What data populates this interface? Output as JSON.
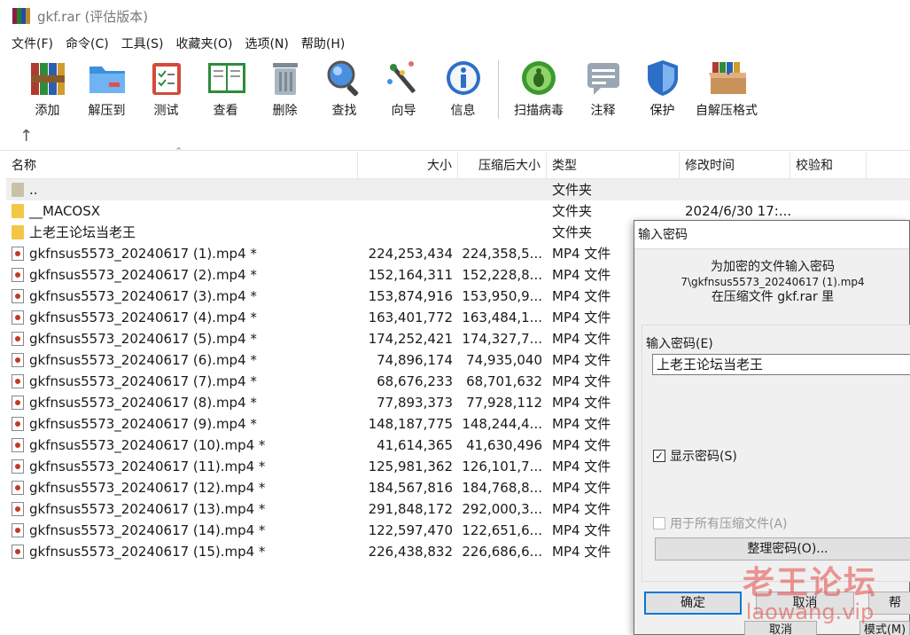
{
  "window": {
    "title": "gkf.rar (评估版本)"
  },
  "menu": [
    "文件(F)",
    "命令(C)",
    "工具(S)",
    "收藏夹(O)",
    "选项(N)",
    "帮助(H)"
  ],
  "toolbar": [
    {
      "label": "添加",
      "icon": "add-books-icon"
    },
    {
      "label": "解压到",
      "icon": "extract-folder-icon"
    },
    {
      "label": "测试",
      "icon": "test-clipboard-icon"
    },
    {
      "label": "查看",
      "icon": "view-book-icon"
    },
    {
      "label": "删除",
      "icon": "trash-icon"
    },
    {
      "label": "查找",
      "icon": "magnifier-icon"
    },
    {
      "label": "向导",
      "icon": "wizard-wand-icon"
    },
    {
      "label": "信息",
      "icon": "info-icon"
    },
    {
      "label": "扫描病毒",
      "icon": "virus-scan-icon"
    },
    {
      "label": "注释",
      "icon": "comment-icon"
    },
    {
      "label": "保护",
      "icon": "shield-icon"
    },
    {
      "label": "自解压格式",
      "icon": "sfx-box-icon"
    }
  ],
  "columns": {
    "name": "名称",
    "size": "大小",
    "packed": "压缩后大小",
    "type": "类型",
    "modified": "修改时间",
    "crc": "校验和"
  },
  "rows": [
    {
      "name": "..",
      "size": "",
      "packed": "",
      "type": "文件夹",
      "modified": "",
      "kind": "parent"
    },
    {
      "name": "__MACOSX",
      "size": "",
      "packed": "",
      "type": "文件夹",
      "modified": "2024/6/30 17:...",
      "kind": "folder"
    },
    {
      "name": "上老王论坛当老王",
      "size": "",
      "packed": "",
      "type": "文件夹",
      "modified": "",
      "kind": "folder"
    },
    {
      "name": "gkfnsus5573_20240617 (1).mp4 *",
      "size": "224,253,434",
      "packed": "224,358,5...",
      "type": "MP4 文件",
      "modified": "",
      "kind": "file"
    },
    {
      "name": "gkfnsus5573_20240617 (2).mp4 *",
      "size": "152,164,311",
      "packed": "152,228,8...",
      "type": "MP4 文件",
      "modified": "",
      "kind": "file"
    },
    {
      "name": "gkfnsus5573_20240617 (3).mp4 *",
      "size": "153,874,916",
      "packed": "153,950,9...",
      "type": "MP4 文件",
      "modified": "",
      "kind": "file"
    },
    {
      "name": "gkfnsus5573_20240617 (4).mp4 *",
      "size": "163,401,772",
      "packed": "163,484,1...",
      "type": "MP4 文件",
      "modified": "",
      "kind": "file"
    },
    {
      "name": "gkfnsus5573_20240617 (5).mp4 *",
      "size": "174,252,421",
      "packed": "174,327,7...",
      "type": "MP4 文件",
      "modified": "",
      "kind": "file"
    },
    {
      "name": "gkfnsus5573_20240617 (6).mp4 *",
      "size": "74,896,174",
      "packed": "74,935,040",
      "type": "MP4 文件",
      "modified": "",
      "kind": "file"
    },
    {
      "name": "gkfnsus5573_20240617 (7).mp4 *",
      "size": "68,676,233",
      "packed": "68,701,632",
      "type": "MP4 文件",
      "modified": "",
      "kind": "file"
    },
    {
      "name": "gkfnsus5573_20240617 (8).mp4 *",
      "size": "77,893,373",
      "packed": "77,928,112",
      "type": "MP4 文件",
      "modified": "",
      "kind": "file"
    },
    {
      "name": "gkfnsus5573_20240617 (9).mp4 *",
      "size": "148,187,775",
      "packed": "148,244,4...",
      "type": "MP4 文件",
      "modified": "",
      "kind": "file"
    },
    {
      "name": "gkfnsus5573_20240617 (10).mp4 *",
      "size": "41,614,365",
      "packed": "41,630,496",
      "type": "MP4 文件",
      "modified": "",
      "kind": "file"
    },
    {
      "name": "gkfnsus5573_20240617 (11).mp4 *",
      "size": "125,981,362",
      "packed": "126,101,7...",
      "type": "MP4 文件",
      "modified": "",
      "kind": "file"
    },
    {
      "name": "gkfnsus5573_20240617 (12).mp4 *",
      "size": "184,567,816",
      "packed": "184,768,8...",
      "type": "MP4 文件",
      "modified": "",
      "kind": "file"
    },
    {
      "name": "gkfnsus5573_20240617 (13).mp4 *",
      "size": "291,848,172",
      "packed": "292,000,3...",
      "type": "MP4 文件",
      "modified": "",
      "kind": "file"
    },
    {
      "name": "gkfnsus5573_20240617 (14).mp4 *",
      "size": "122,597,470",
      "packed": "122,651,6...",
      "type": "MP4 文件",
      "modified": "",
      "kind": "file"
    },
    {
      "name": "gkfnsus5573_20240617 (15).mp4 *",
      "size": "226,438,832",
      "packed": "226,686,6...",
      "type": "MP4 文件",
      "modified": "",
      "kind": "file"
    }
  ],
  "dialog": {
    "title": "输入密码",
    "info_line1": "为加密的文件输入密码",
    "info_line2": "7\\gkfnsus5573_20240617 (1).mp4",
    "info_line3": "在压缩文件 gkf.rar 里",
    "password_label": "输入密码(E)",
    "password_value": "上老王论坛当老王",
    "show_password": "显示密码(S)",
    "show_password_checked": true,
    "use_all": "用于所有压缩文件(A)",
    "organize": "整理密码(O)...",
    "ok": "确定",
    "cancel": "取消",
    "help": "帮"
  },
  "behind_buttons": {
    "cancel": "取消",
    "mode": "模式(M)"
  },
  "watermark": {
    "cn": "老王论坛",
    "en": "laowang.vip"
  }
}
